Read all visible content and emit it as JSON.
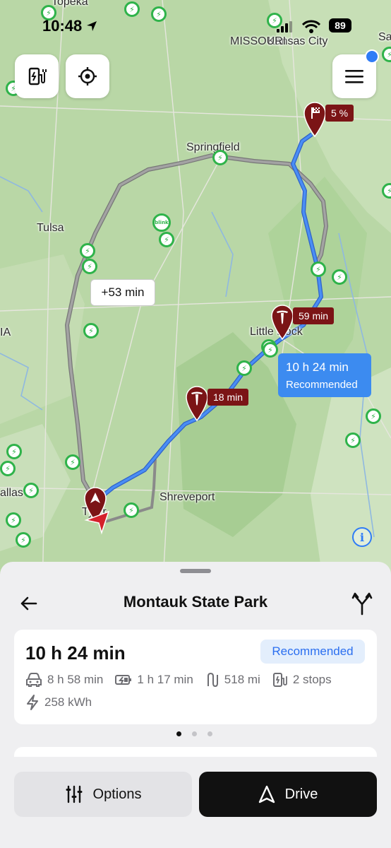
{
  "status_bar": {
    "time": "10:48",
    "battery": "89"
  },
  "map": {
    "cities": {
      "topeka": "Topeka",
      "missouri": "MISSOURI",
      "kansas_city": "Kansas City",
      "springfield": "Springfield",
      "tulsa": "Tulsa",
      "little_rock": "Little Rock",
      "shreveport": "Shreveport",
      "tyler": "Tyler",
      "dallas": "allas",
      "ia": "IA",
      "sa": "Sa"
    },
    "destination_pin": {
      "icon": "finish-flag-icon",
      "label": "5 %"
    },
    "stops": [
      {
        "label": "59 min",
        "icon": "tesla-logo-icon"
      },
      {
        "label": "18 min",
        "icon": "tesla-logo-icon"
      }
    ],
    "alternate_route": {
      "label": "+53 min"
    },
    "selected_route": {
      "duration": "10 h 24 min",
      "tag": "Recommended"
    },
    "blink_charger": "blink",
    "colors": {
      "route": "#3c7ff0",
      "alt_route": "#8c8c8c",
      "pin": "#7b1416",
      "charger": "#2fb34a"
    }
  },
  "sheet": {
    "title": "Montauk State Park",
    "route_card": {
      "duration": "10 h 24 min",
      "badge": "Recommended",
      "drive_time": "8 h 58 min",
      "charge_time": "1 h 17 min",
      "distance": "518 mi",
      "stops": "2 stops",
      "energy": "258 kWh"
    },
    "pager": {
      "count": 3,
      "active": 0
    },
    "buttons": {
      "options": "Options",
      "drive": "Drive"
    }
  }
}
